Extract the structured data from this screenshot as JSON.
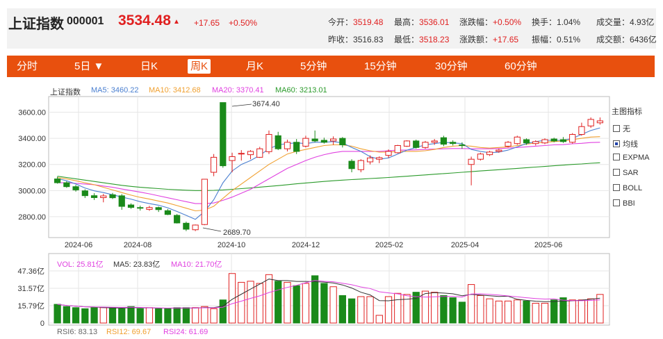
{
  "quote": {
    "name": "上证指数",
    "code": "000001",
    "price": "3534.48",
    "arrow": "▲",
    "change": "+17.65",
    "change_pct": "+0.50%"
  },
  "stats": {
    "open_label": "今开：",
    "open": "3519.48",
    "high_label": "最高：",
    "high": "3536.01",
    "pct_label": "涨跌幅：",
    "pct": "+0.50%",
    "turnover_label": "换手：",
    "turnover": "1.04%",
    "volume_label": "成交量：",
    "volume": "4.93亿",
    "prev_label": "昨收：",
    "prev": "3516.83",
    "low_label": "最低：",
    "low": "3518.23",
    "chgamt_label": "涨跌额：",
    "chgamt": "+17.65",
    "amplitude_label": "振幅：",
    "amplitude": "0.51%",
    "amount_label": "成交额：",
    "amount": "6436亿"
  },
  "tabs": [
    "分时",
    "5日 ▼",
    "日K",
    "周K",
    "月K",
    "5分钟",
    "15分钟",
    "30分钟",
    "60分钟"
  ],
  "active_tab": "周K",
  "legend": {
    "name": "上证指数",
    "ma5": "MA5: 3460.22",
    "ma10": "MA10: 3412.68",
    "ma20": "MA20: 3370.41",
    "ma60": "MA60: 3213.01"
  },
  "colors": {
    "up": "#e02020",
    "down": "#1a8a1a",
    "ma5": "#4a7fd0",
    "ma10": "#f0a030",
    "ma20": "#e040e0",
    "ma60": "#2a9a2a",
    "accent": "#e8500e"
  },
  "indicators": {
    "title": "主图指标",
    "items": [
      {
        "label": "无",
        "checked": false
      },
      {
        "label": "均线",
        "checked": true
      },
      {
        "label": "EXPMA",
        "checked": false
      },
      {
        "label": "SAR",
        "checked": false
      },
      {
        "label": "BOLL",
        "checked": false
      },
      {
        "label": "BBI",
        "checked": false
      }
    ]
  },
  "annotations": {
    "high": "3674.40",
    "low": "2689.70"
  },
  "volume_legend": {
    "vol": "VOL: 25.81亿",
    "ma5": "MA5: 23.83亿",
    "ma10": "MA10: 21.70亿"
  },
  "rsi_legend": {
    "rsi6": "RSI6: 83.13",
    "rsi12": "RSI12: 69.67",
    "rsi24": "RSI24: 61.69"
  },
  "chart_data": {
    "type": "candlestick",
    "x_ticks": [
      "2024-06",
      "2024-08",
      "2024-10",
      "2024-12",
      "2025-02",
      "2025-04",
      "2025-06"
    ],
    "y_ticks": [
      2800,
      3000,
      3200,
      3400,
      3600
    ],
    "y_tick_labels": [
      "2800.00",
      "3000.00",
      "3200.00",
      "3400.00",
      "3600.00"
    ],
    "ylim": [
      2640,
      3720
    ],
    "candles": [
      {
        "o": 3089,
        "h": 3106,
        "l": 3053,
        "c": 3060
      },
      {
        "o": 3060,
        "h": 3072,
        "l": 3021,
        "c": 3030
      },
      {
        "o": 3030,
        "h": 3043,
        "l": 2992,
        "c": 3005
      },
      {
        "o": 2998,
        "h": 3010,
        "l": 2943,
        "c": 2961
      },
      {
        "o": 2961,
        "h": 2980,
        "l": 2928,
        "c": 2946
      },
      {
        "o": 2946,
        "h": 2975,
        "l": 2910,
        "c": 2959
      },
      {
        "o": 2968,
        "h": 2982,
        "l": 2935,
        "c": 2945
      },
      {
        "o": 2960,
        "h": 2973,
        "l": 2853,
        "c": 2879
      },
      {
        "o": 2890,
        "h": 2902,
        "l": 2860,
        "c": 2871
      },
      {
        "o": 2870,
        "h": 2885,
        "l": 2847,
        "c": 2866
      },
      {
        "o": 2856,
        "h": 2883,
        "l": 2845,
        "c": 2870
      },
      {
        "o": 2870,
        "h": 2878,
        "l": 2836,
        "c": 2854
      },
      {
        "o": 2846,
        "h": 2859,
        "l": 2812,
        "c": 2817
      },
      {
        "o": 2810,
        "h": 2820,
        "l": 2748,
        "c": 2752
      },
      {
        "o": 2750,
        "h": 2762,
        "l": 2690,
        "c": 2704
      },
      {
        "o": 2700,
        "h": 2740,
        "l": 2689.7,
        "c": 2736
      },
      {
        "o": 2740,
        "h": 3087,
        "l": 2735,
        "c": 3087
      },
      {
        "o": 3140,
        "h": 3280,
        "l": 3110,
        "c": 3255
      },
      {
        "o": 3674,
        "h": 3674.4,
        "l": 3175,
        "c": 3190
      },
      {
        "o": 3230,
        "h": 3290,
        "l": 3140,
        "c": 3260
      },
      {
        "o": 3280,
        "h": 3310,
        "l": 3230,
        "c": 3285
      },
      {
        "o": 3275,
        "h": 3310,
        "l": 3240,
        "c": 3300
      },
      {
        "o": 3255,
        "h": 3335,
        "l": 3250,
        "c": 3320
      },
      {
        "o": 3298,
        "h": 3460,
        "l": 3280,
        "c": 3430
      },
      {
        "o": 3420,
        "h": 3450,
        "l": 3310,
        "c": 3320
      },
      {
        "o": 3320,
        "h": 3390,
        "l": 3300,
        "c": 3370
      },
      {
        "o": 3370,
        "h": 3395,
        "l": 3280,
        "c": 3300
      },
      {
        "o": 3340,
        "h": 3420,
        "l": 3330,
        "c": 3400
      },
      {
        "o": 3395,
        "h": 3460,
        "l": 3370,
        "c": 3380
      },
      {
        "o": 3385,
        "h": 3405,
        "l": 3360,
        "c": 3370
      },
      {
        "o": 3380,
        "h": 3415,
        "l": 3350,
        "c": 3395
      },
      {
        "o": 3400,
        "h": 3410,
        "l": 3330,
        "c": 3350
      },
      {
        "o": 3225,
        "h": 3240,
        "l": 3140,
        "c": 3168
      },
      {
        "o": 3160,
        "h": 3240,
        "l": 3140,
        "c": 3230
      },
      {
        "o": 3220,
        "h": 3270,
        "l": 3200,
        "c": 3250
      },
      {
        "o": 3240,
        "h": 3262,
        "l": 3210,
        "c": 3252
      },
      {
        "o": 3270,
        "h": 3315,
        "l": 3250,
        "c": 3300
      },
      {
        "o": 3290,
        "h": 3350,
        "l": 3285,
        "c": 3345
      },
      {
        "o": 3340,
        "h": 3385,
        "l": 3335,
        "c": 3380
      },
      {
        "o": 3380,
        "h": 3390,
        "l": 3320,
        "c": 3330
      },
      {
        "o": 3330,
        "h": 3380,
        "l": 3320,
        "c": 3370
      },
      {
        "o": 3370,
        "h": 3395,
        "l": 3350,
        "c": 3380
      },
      {
        "o": 3405,
        "h": 3420,
        "l": 3340,
        "c": 3355
      },
      {
        "o": 3370,
        "h": 3385,
        "l": 3345,
        "c": 3360
      },
      {
        "o": 3350,
        "h": 3370,
        "l": 3320,
        "c": 3345
      },
      {
        "o": 3200,
        "h": 3260,
        "l": 3040,
        "c": 3240
      },
      {
        "o": 3240,
        "h": 3290,
        "l": 3230,
        "c": 3280
      },
      {
        "o": 3275,
        "h": 3305,
        "l": 3265,
        "c": 3295
      },
      {
        "o": 3300,
        "h": 3320,
        "l": 3290,
        "c": 3310
      },
      {
        "o": 3340,
        "h": 3380,
        "l": 3330,
        "c": 3370
      },
      {
        "o": 3360,
        "h": 3420,
        "l": 3350,
        "c": 3410
      },
      {
        "o": 3390,
        "h": 3400,
        "l": 3350,
        "c": 3365
      },
      {
        "o": 3360,
        "h": 3385,
        "l": 3345,
        "c": 3375
      },
      {
        "o": 3365,
        "h": 3400,
        "l": 3355,
        "c": 3390
      },
      {
        "o": 3395,
        "h": 3405,
        "l": 3370,
        "c": 3380
      },
      {
        "o": 3390,
        "h": 3410,
        "l": 3365,
        "c": 3375
      },
      {
        "o": 3370,
        "h": 3440,
        "l": 3360,
        "c": 3430
      },
      {
        "o": 3430,
        "h": 3520,
        "l": 3420,
        "c": 3490
      },
      {
        "o": 3495,
        "h": 3560,
        "l": 3480,
        "c": 3545
      },
      {
        "o": 3519,
        "h": 3560,
        "l": 3505,
        "c": 3534
      }
    ],
    "ma5": [
      3092,
      3075,
      3050,
      3020,
      2998,
      2985,
      2968,
      2950,
      2935,
      2915,
      2900,
      2888,
      2868,
      2840,
      2810,
      2780,
      2840,
      2930,
      3060,
      3150,
      3200,
      3230,
      3270,
      3320,
      3350,
      3360,
      3365,
      3360,
      3370,
      3370,
      3375,
      3365,
      3330,
      3300,
      3260,
      3240,
      3250,
      3280,
      3310,
      3330,
      3350,
      3360,
      3370,
      3365,
      3360,
      3315,
      3300,
      3290,
      3295,
      3310,
      3335,
      3360,
      3375,
      3385,
      3385,
      3385,
      3400,
      3430,
      3460,
      3480
    ],
    "ma10": [
      3100,
      3090,
      3075,
      3060,
      3045,
      3025,
      3005,
      2985,
      2965,
      2948,
      2935,
      2920,
      2905,
      2885,
      2865,
      2845,
      2850,
      2880,
      2940,
      3000,
      3050,
      3100,
      3150,
      3200,
      3240,
      3280,
      3300,
      3315,
      3330,
      3345,
      3350,
      3350,
      3340,
      3320,
      3305,
      3295,
      3295,
      3300,
      3300,
      3300,
      3305,
      3315,
      3330,
      3340,
      3345,
      3340,
      3330,
      3325,
      3330,
      3335,
      3345,
      3355,
      3365,
      3370,
      3375,
      3380,
      3390,
      3400,
      3410,
      3413
    ],
    "ma20": [
      3060,
      3060,
      3055,
      3050,
      3045,
      3035,
      3025,
      3012,
      3000,
      2988,
      2975,
      2960,
      2945,
      2930,
      2915,
      2900,
      2900,
      2905,
      2925,
      2950,
      2980,
      3010,
      3050,
      3090,
      3130,
      3170,
      3200,
      3230,
      3255,
      3275,
      3290,
      3300,
      3300,
      3300,
      3300,
      3300,
      3305,
      3310,
      3310,
      3312,
      3315,
      3318,
      3320,
      3322,
      3322,
      3320,
      3320,
      3320,
      3322,
      3325,
      3330,
      3335,
      3340,
      3345,
      3350,
      3352,
      3358,
      3362,
      3368,
      3370
    ],
    "ma60": [
      3110,
      3100,
      3090,
      3080,
      3070,
      3060,
      3050,
      3040,
      3032,
      3025,
      3020,
      3015,
      3010,
      3006,
      3003,
      3000,
      3000,
      3002,
      3005,
      3010,
      3015,
      3020,
      3026,
      3032,
      3038,
      3045,
      3052,
      3058,
      3064,
      3070,
      3075,
      3080,
      3084,
      3088,
      3092,
      3096,
      3100,
      3105,
      3110,
      3115,
      3120,
      3125,
      3130,
      3135,
      3140,
      3145,
      3150,
      3155,
      3160,
      3165,
      3170,
      3175,
      3180,
      3185,
      3190,
      3195,
      3200,
      3204,
      3209,
      3213
    ],
    "volume": {
      "y_tick_labels": [
        "47.36亿",
        "31.57亿",
        "15.79亿",
        "0"
      ],
      "ylim": [
        0,
        47.36
      ],
      "values": [
        17,
        15,
        14,
        13,
        14,
        14,
        14,
        13,
        15,
        13,
        14,
        13,
        13,
        14,
        14,
        14,
        15,
        13,
        21,
        45,
        37,
        38,
        36,
        44,
        38,
        37,
        34,
        36,
        43,
        36,
        33,
        25,
        22,
        24,
        24,
        7,
        24,
        27,
        26,
        28,
        29,
        28,
        25,
        23,
        19,
        35,
        25,
        22,
        20,
        20,
        21,
        20,
        18,
        18,
        21,
        23,
        21,
        21,
        22,
        26
      ]
    }
  }
}
